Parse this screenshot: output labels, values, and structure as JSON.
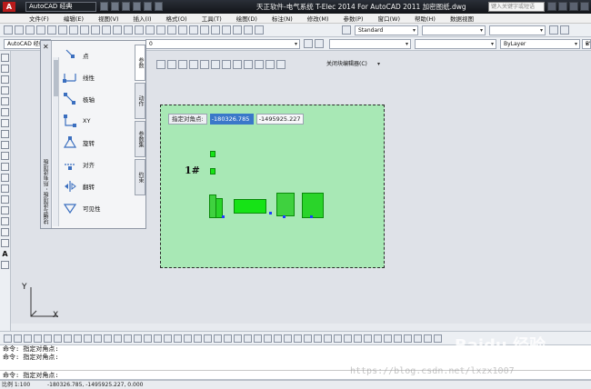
{
  "title_bar": {
    "workspace": "AutoCAD 经典",
    "window_title": "天正软件-电气系统 T-Elec 2014  For AutoCAD 2011    加密图纸.dwg",
    "help_search_placeholder": "键入关键字或短语"
  },
  "menu": [
    "文件(F)",
    "编辑(E)",
    "视图(V)",
    "插入(I)",
    "格式(O)",
    "工具(T)",
    "绘图(D)",
    "标注(N)",
    "修改(M)",
    "参数(P)",
    "窗口(W)",
    "帮助(H)",
    "数据视图"
  ],
  "toolbar": {
    "workspace_combo": "AutoCAD 经典",
    "text_style_combo": "Standard",
    "layer_combo": "0",
    "linetype_combo": "ByLayer",
    "lineweight_combo": "BYC",
    "close_block_editor": "关闭块编辑器(C)"
  },
  "palette": {
    "title": "块编写选项板 - 所有选项板",
    "items": [
      {
        "label": "点",
        "icon": "point-parameter-icon"
      },
      {
        "label": "线性",
        "icon": "linear-parameter-icon"
      },
      {
        "label": "极轴",
        "icon": "polar-parameter-icon"
      },
      {
        "label": "XY",
        "icon": "xy-parameter-icon"
      },
      {
        "label": "旋转",
        "icon": "rotation-parameter-icon"
      },
      {
        "label": "对齐",
        "icon": "alignment-parameter-icon"
      },
      {
        "label": "翻转",
        "icon": "flip-parameter-icon"
      },
      {
        "label": "可见性",
        "icon": "visibility-parameter-icon"
      }
    ],
    "tabs": [
      "参数",
      "动作",
      "参数集",
      "约束"
    ]
  },
  "dynamic_input": {
    "label": "指定对角点:",
    "x_value": "-180326.785",
    "y_value": "-1495925.227"
  },
  "drawing_label": "1#",
  "axis": {
    "y": "Y",
    "x": "X"
  },
  "command_line": {
    "lines": [
      "命令: 指定对角点:",
      "命令: 指定对角点:"
    ],
    "current": "命令: 指定对角点:"
  },
  "status": {
    "scale": "比例 1:100",
    "coords": "-180326.785, -1495925.227, 0.000"
  },
  "watermark": {
    "logo": "Baidu 经验",
    "url": "https://blog.csdn.net/lxzx1007"
  },
  "colors": {
    "drawing_background": "#a8e8b5",
    "block_green": "#16e316",
    "title_bar": "#1a1d22",
    "dyn_highlight": "#3a78c9"
  }
}
